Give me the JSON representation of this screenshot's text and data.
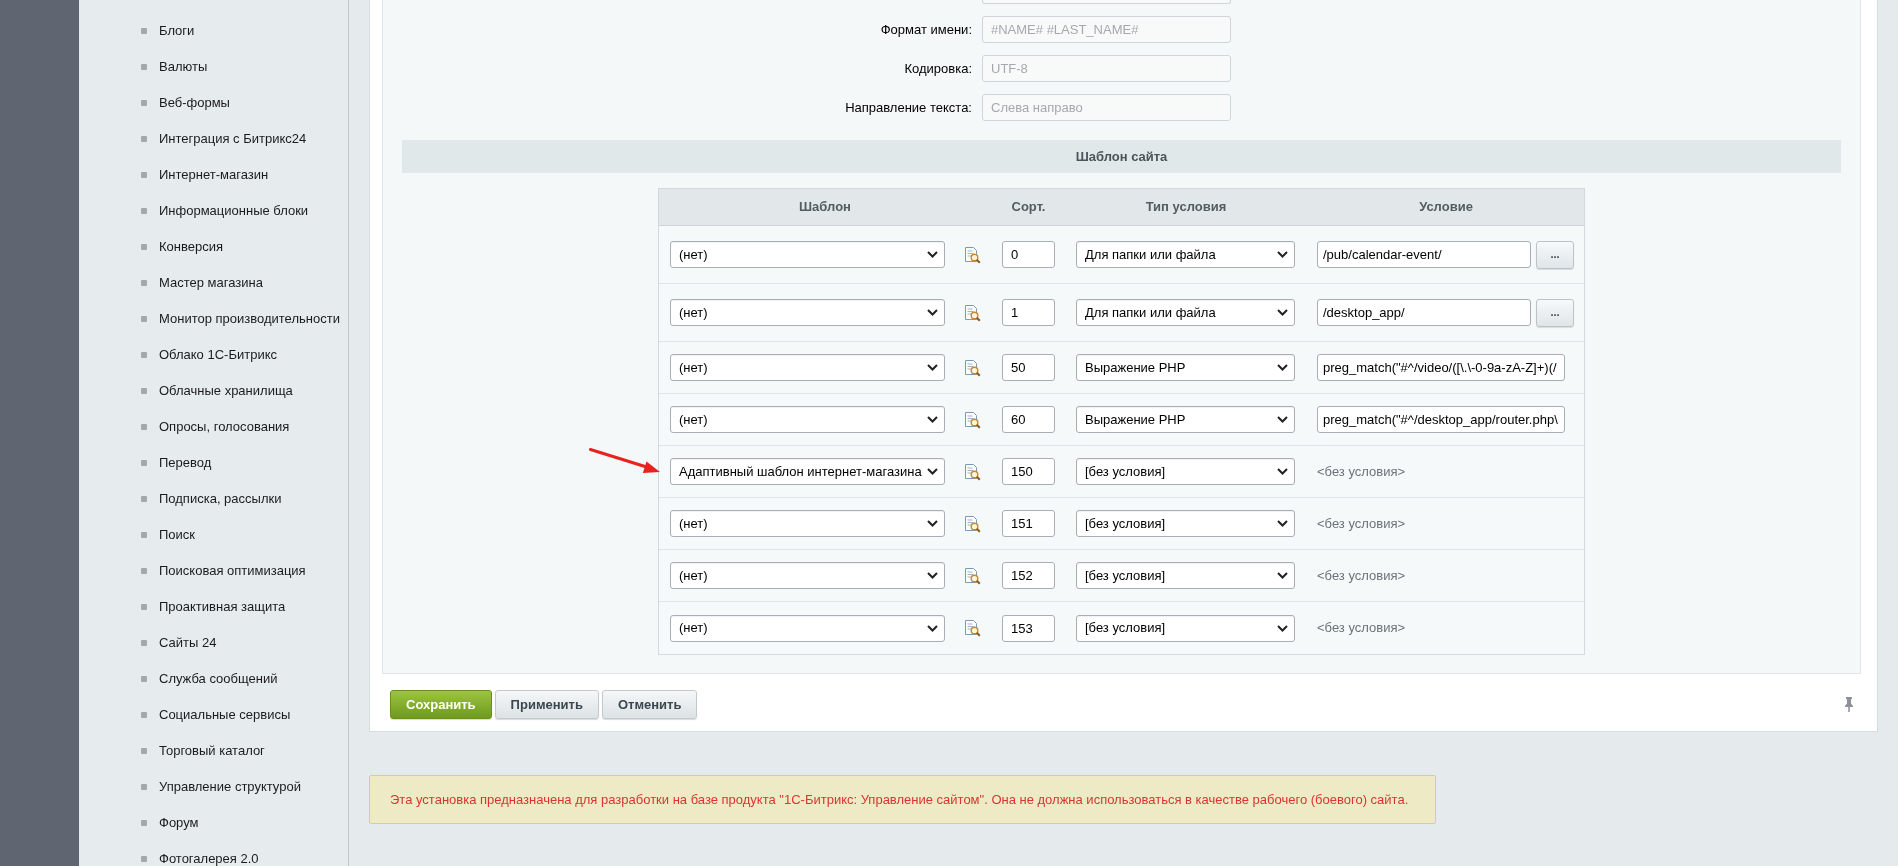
{
  "sidebar": {
    "items": [
      "Блоги",
      "Валюты",
      "Веб-формы",
      "Интеграция с Битрикс24",
      "Интернет-магазин",
      "Информационные блоки",
      "Конверсия",
      "Мастер магазина",
      "Монитор производительности",
      "Облако 1С-Битрикс",
      "Облачные хранилища",
      "Опросы, голосования",
      "Перевод",
      "Подписка, рассылки",
      "Поиск",
      "Поисковая оптимизация",
      "Проактивная защита",
      "Сайты 24",
      "Служба сообщений",
      "Социальные сервисы",
      "Торговый каталог",
      "Управление структурой",
      "Форум",
      "Фотогалерея 2.0"
    ]
  },
  "form": {
    "fields": [
      {
        "kind": "partial"
      },
      {
        "kind": "text",
        "label": "Формат имени:",
        "value": "#NAME# #LAST_NAME#",
        "disabled": true
      },
      {
        "kind": "text",
        "label": "Кодировка:",
        "value": "UTF-8",
        "disabled": true
      },
      {
        "kind": "text",
        "label": "Направление текста:",
        "value": "Слева направо",
        "disabled": true
      }
    ]
  },
  "site_template": {
    "title": "Шаблон сайта",
    "columns": [
      "Шаблон",
      "Сорт.",
      "Тип условия",
      "Условие"
    ],
    "rows": [
      {
        "template": "(нет)",
        "sort": "0",
        "condition_type": "Для папки или файла",
        "condition": {
          "kind": "input",
          "value": "/pub/calendar-event/",
          "button": "..."
        },
        "pointer_arrow": false
      },
      {
        "template": "(нет)",
        "sort": "1",
        "condition_type": "Для папки или файла",
        "condition": {
          "kind": "input",
          "value": "/desktop_app/",
          "button": "..."
        },
        "pointer_arrow": false
      },
      {
        "template": "(нет)",
        "sort": "50",
        "condition_type": "Выражение PHP",
        "condition": {
          "kind": "input",
          "value": "preg_match(\"#^/video/([\\.\\-0-9a-zA-Z]+)(/"
        },
        "pointer_arrow": false
      },
      {
        "template": "(нет)",
        "sort": "60",
        "condition_type": "Выражение PHP",
        "condition": {
          "kind": "input",
          "value": "preg_match(\"#^/desktop_app/router.php\\"
        },
        "pointer_arrow": false
      },
      {
        "template": "Адаптивный шаблон интернет-магазина",
        "sort": "150",
        "condition_type": "[без условия]",
        "condition": {
          "kind": "text",
          "value": "<без условия>"
        },
        "pointer_arrow": true
      },
      {
        "template": "(нет)",
        "sort": "151",
        "condition_type": "[без условия]",
        "condition": {
          "kind": "text",
          "value": "<без условия>"
        },
        "pointer_arrow": false
      },
      {
        "template": "(нет)",
        "sort": "152",
        "condition_type": "[без условия]",
        "condition": {
          "kind": "text",
          "value": "<без условия>"
        },
        "pointer_arrow": false
      },
      {
        "template": "(нет)",
        "sort": "153",
        "condition_type": "[без условия]",
        "condition": {
          "kind": "text",
          "value": "<без условия>"
        },
        "pointer_arrow": false
      }
    ]
  },
  "buttons": [
    {
      "label": "Сохранить",
      "kind": "primary"
    },
    {
      "label": "Применить",
      "kind": "secondary"
    },
    {
      "label": "Отменить",
      "kind": "secondary"
    }
  ],
  "notice": "Эта установка предназначена для разработки на базе продукта \"1С-Битрикс: Управление сайтом\". Она не должна использоваться в качестве рабочего (боевого) сайта."
}
